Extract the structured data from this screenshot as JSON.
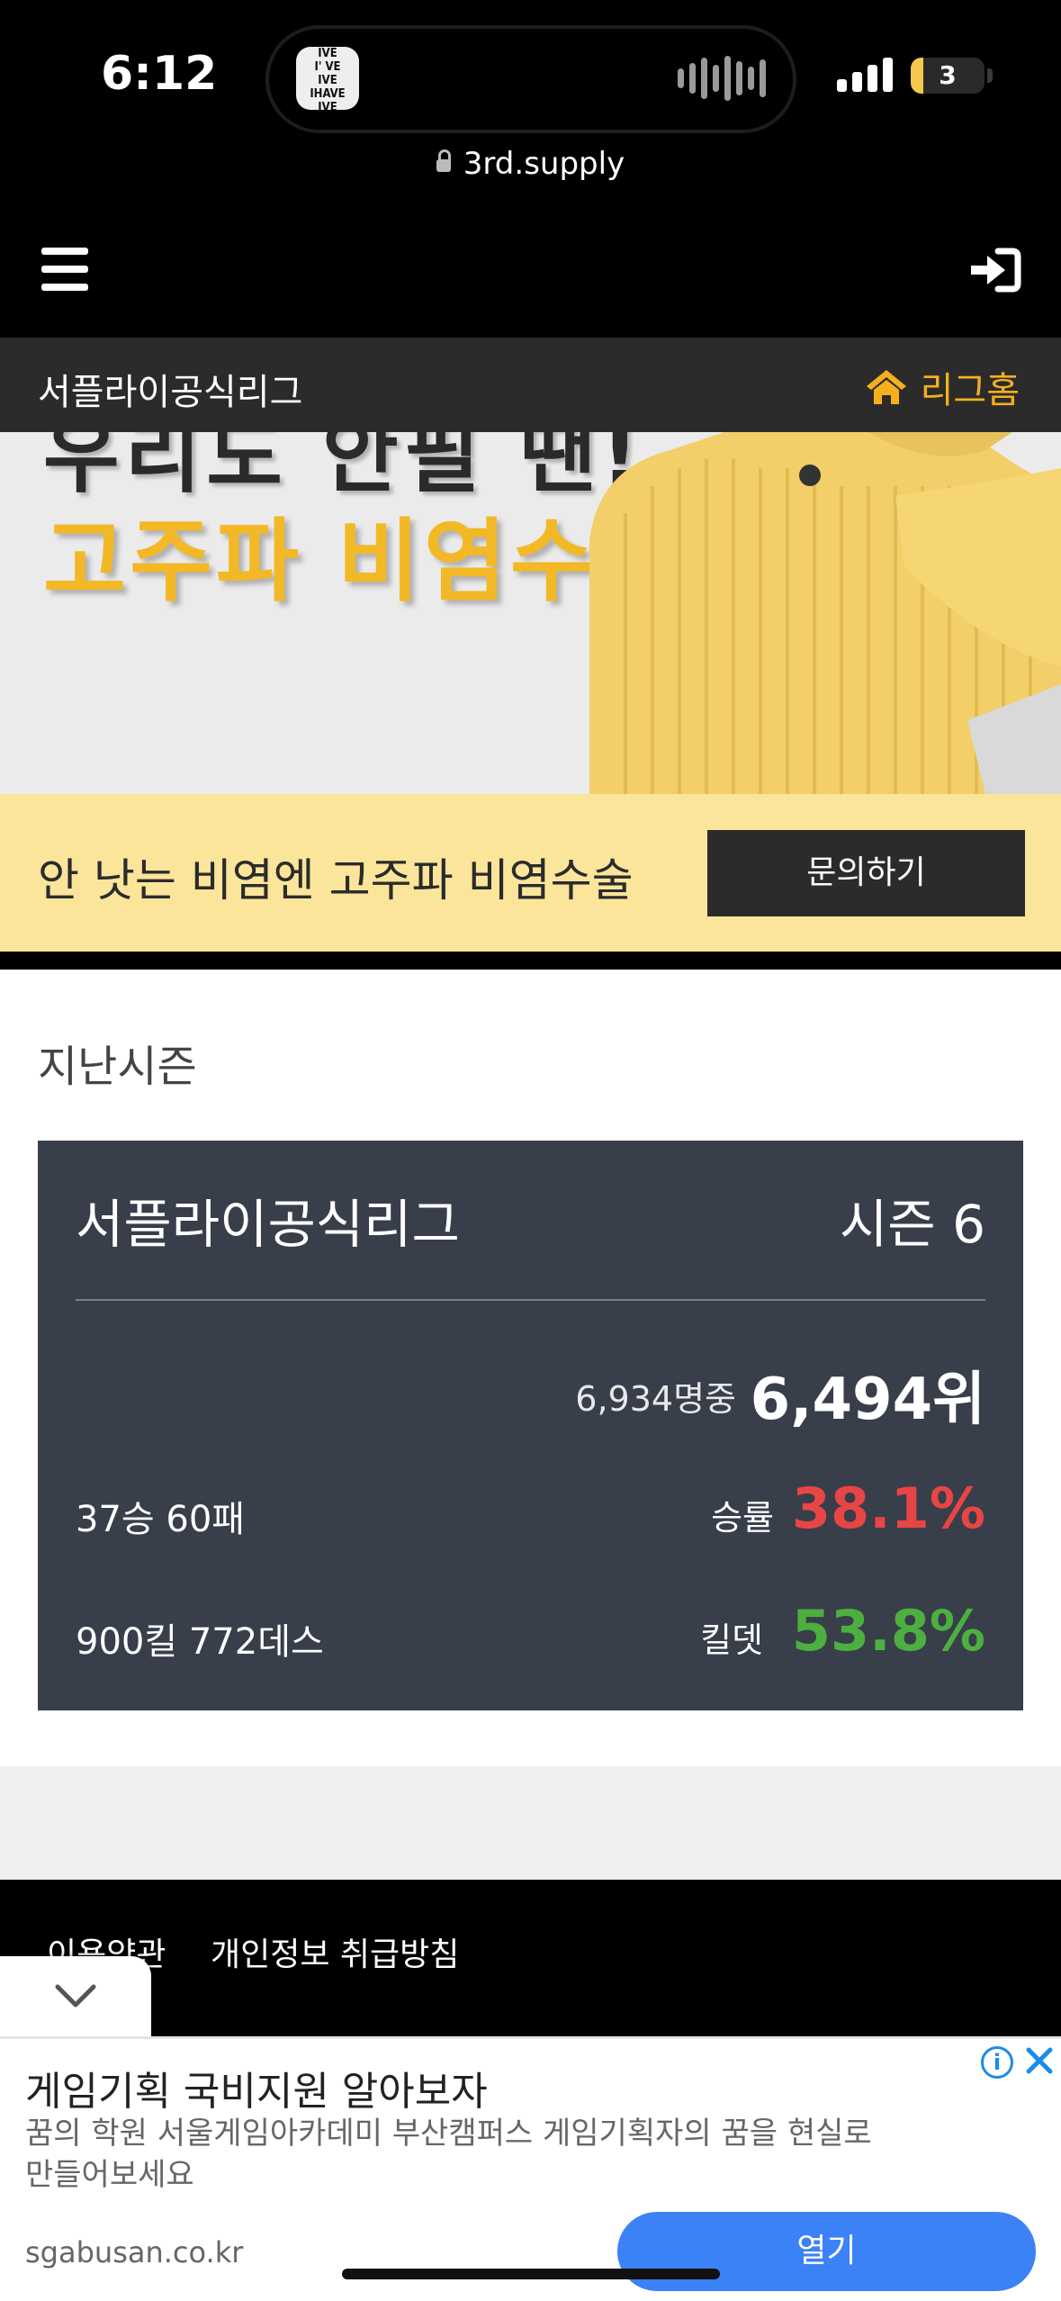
{
  "status_bar": {
    "time": "6:12",
    "battery_level": "3",
    "island_app_lines": [
      "IVE",
      "I' VE",
      "IVE",
      "IHAVE",
      "IVE"
    ]
  },
  "browser": {
    "url": "3rd.supply"
  },
  "nav": {
    "league_name": "서플라이공식리그",
    "league_home_label": "리그홈"
  },
  "banner": {
    "top_text_partial": "우리도 안필 땐!",
    "headline": "고주파 비염수술"
  },
  "promo": {
    "text": "안 낫는 비염엔 고주파 비염수술",
    "button_label": "문의하기"
  },
  "content": {
    "section_title": "지난시즌",
    "season_card": {
      "league": "서플라이공식리그",
      "season": "시즌 6",
      "rank_of": "6,934명중",
      "rank": "6,494위",
      "record": "37승  60패",
      "winrate_label": "승률",
      "winrate": "38.1%",
      "kills_deaths": "900킬  772데스",
      "kd_label": "킬뎃",
      "kd": "53.8%"
    }
  },
  "footer": {
    "links": [
      "이용약관",
      "개인정보 취급방침"
    ]
  },
  "ad": {
    "title": "게임기획 국비지원 알아보자",
    "description": "꿈의 학원 서울게임아카데미 부산캠퍼스 게임기획자의 꿈을 현실로 만들어보세요",
    "domain": "sgabusan.co.kr",
    "button_label": "열기",
    "info_symbol": "i"
  },
  "colors": {
    "accent_yellow": "#f5b01c",
    "winrate_red": "#e84545",
    "kd_green": "#4caf3f",
    "card_bg": "#383e4a",
    "ad_button_blue": "#3b82f6"
  }
}
